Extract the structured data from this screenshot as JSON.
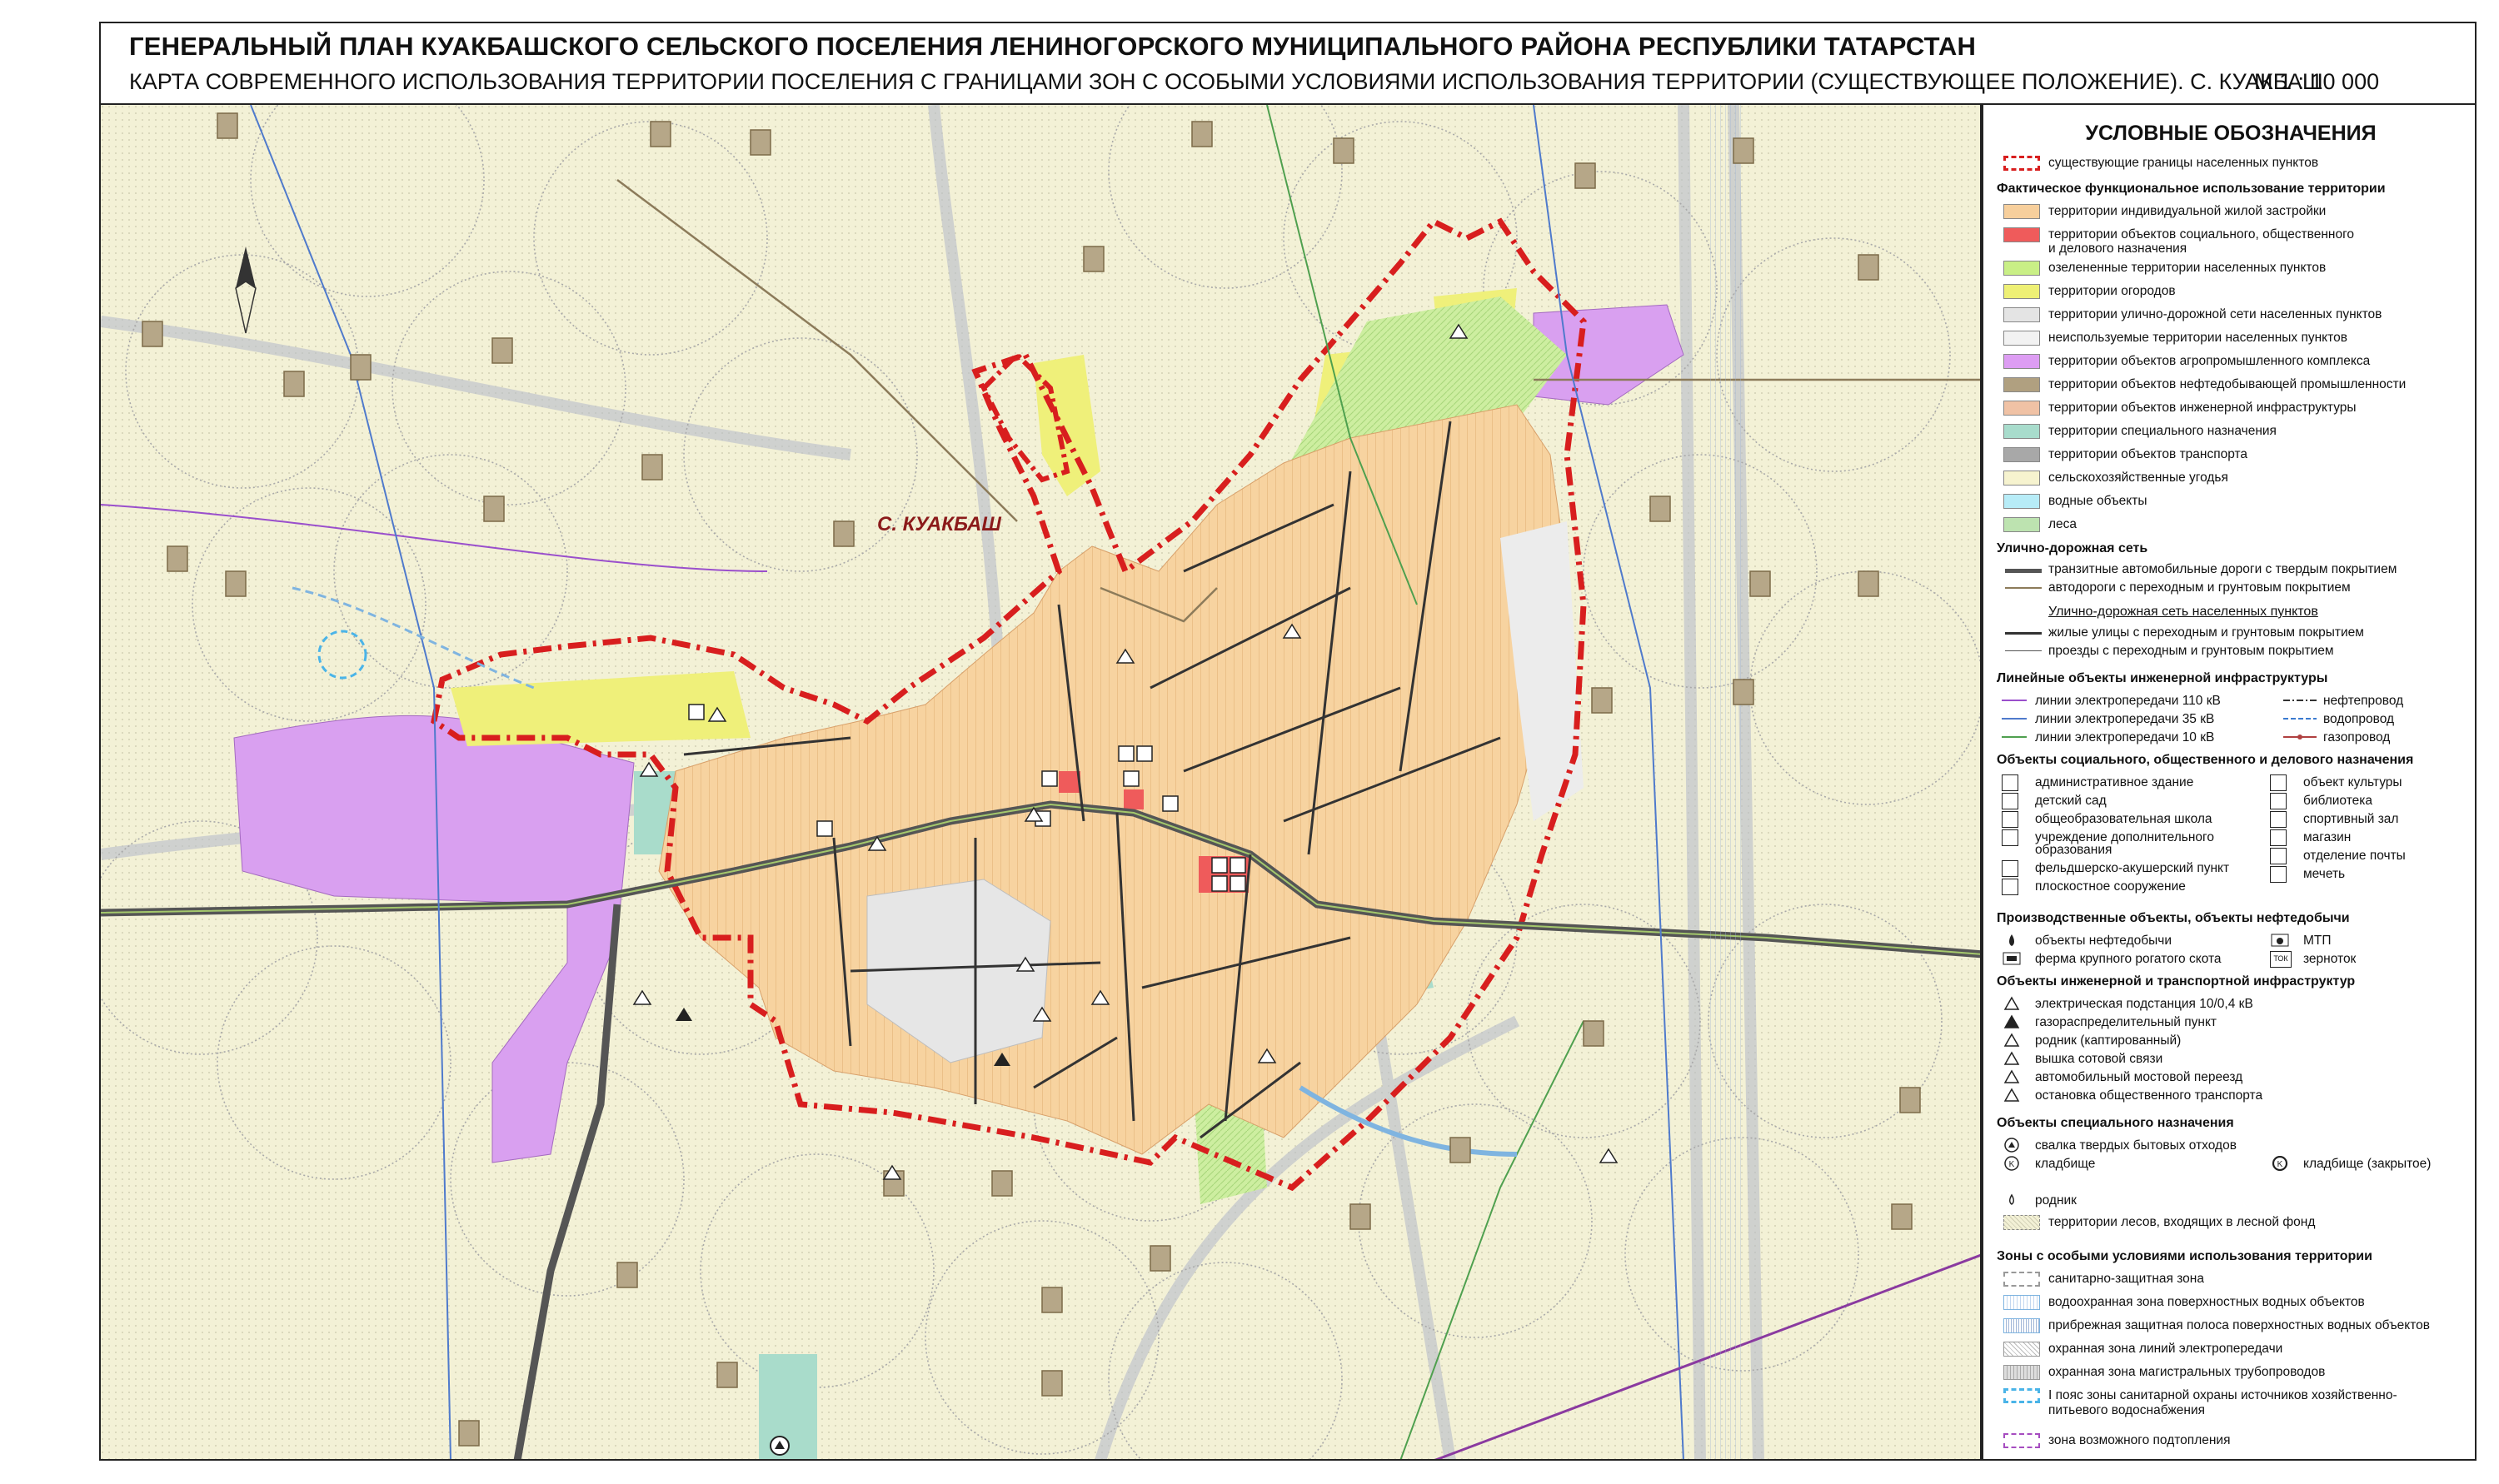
{
  "header": {
    "title": "ГЕНЕРАЛЬНЫЙ ПЛАН КУАКБАШСКОГО СЕЛЬСКОГО ПОСЕЛЕНИЯ ЛЕНИНОГОРСКОГО МУНИЦИПАЛЬНОГО РАЙОНА РЕСПУБЛИКИ ТАТАРСТАН",
    "subtitle": "КАРТА СОВРЕМЕННОГО ИСПОЛЬЗОВАНИЯ ТЕРРИТОРИИ ПОСЕЛЕНИЯ С ГРАНИЦАМИ ЗОН С ОСОБЫМИ УСЛОВИЯМИ ИСПОЛЬЗОВАНИЯ ТЕРРИТОРИИ (СУЩЕСТВУЮЩЕЕ ПОЛОЖЕНИЕ).  С. КУАКБАШ",
    "scale": "М  1 : 10 000"
  },
  "map": {
    "settlement_label": "С. КУАКБАШ",
    "north_symbol": "north-arrow-icon",
    "colors": {
      "background": "#f3f1d6",
      "residential": "#f7d3a0",
      "agro": "#d9a0f0",
      "orchards": "#eff07a",
      "greenery": "#cdeea0",
      "cemetery": "#a9dccb",
      "unused": "#e6e6e6",
      "boundary": "#d81e1e"
    }
  },
  "legend": {
    "title": "УСЛОВНЫЕ ОБОЗНАЧЕНИЯ",
    "boundary": "существующие границы населенных пунктов",
    "landuse_title": "Фактическое функциональное использование территории",
    "landuse": [
      {
        "label": "территории индивидуальной жилой застройки",
        "color": "#f7cf9c"
      },
      {
        "label": "территории объектов социального, общественного",
        "label2": "и делового назначения",
        "color": "#ef5b5b"
      },
      {
        "label": "озелененные территории населенных пунктов",
        "color": "#c9ef86"
      },
      {
        "label": "территории огородов",
        "color": "#eef075"
      },
      {
        "label": "территории улично-дорожной сети населенных пунктов",
        "color": "#e4e4e4"
      },
      {
        "label": "неиспользуемые территории населенных пунктов",
        "color": "#f2f2f2"
      },
      {
        "label": "территории объектов агропромышленного комплекса",
        "color": "#dd9df3"
      },
      {
        "label": "территории объектов нефтедобывающей промышленности",
        "color": "#b0a080"
      },
      {
        "label": "территории объектов инженерной инфраструктуры",
        "color": "#f0c2a5"
      },
      {
        "label": "территории специального назначения",
        "color": "#a8dccc"
      },
      {
        "label": "территории объектов транспорта",
        "color": "#a8a8a8"
      },
      {
        "label": "сельскохозяйственные угодья",
        "color": "#f6f3cf"
      },
      {
        "label": "водные объекты",
        "color": "#b7ecf7"
      },
      {
        "label": "леса",
        "color": "#bde3b0"
      }
    ],
    "roads_title": "Улично-дорожная сеть",
    "roads": [
      "транзитные автомобильные дороги с твердым покрытием",
      "автодороги с переходным и грунтовым покрытием"
    ],
    "streets_subtitle": "Улично-дорожная сеть населенных пунктов",
    "streets": [
      "жилые улицы с переходным и грунтовым покрытием",
      "проезды с переходным и грунтовым покрытием"
    ],
    "lines_title": "Линейные объекты инженерной инфраструктуры",
    "lines_left": [
      {
        "label": "линии электропередачи 110 кВ",
        "code": "110"
      },
      {
        "label": "линии электропередачи 35 кВ",
        "code": "35"
      },
      {
        "label": "линии электропередачи 10 кВ",
        "code": "10"
      }
    ],
    "lines_right": [
      "нефтепровод",
      "водопровод",
      "газопровод"
    ],
    "social_title": "Объекты социального, общественного и делового назначения",
    "social_left": [
      "административное здание",
      "детский сад",
      "общеобразовательная школа",
      "учреждение дополнительного",
      "образования",
      "фельдшерско-акушерский пункт",
      "плоскостное сооружение"
    ],
    "social_right": [
      "объект культуры",
      "библиотека",
      "спортивный зал",
      "магазин",
      "отделение почты",
      "мечеть"
    ],
    "industry_title": "Производственные объекты, объекты нефтедобычи",
    "industry_left": [
      "объекты нефтедобычи",
      "ферма крупного рогатого скота"
    ],
    "industry_right": [
      "МТП",
      "зерноток"
    ],
    "industry_tok": "ТОК",
    "infra_title": "Объекты инженерной и транспортной инфраструктур",
    "infra": [
      "электрическая подстанция 10/0,4 кВ",
      "газораспределительный пункт",
      "родник (каптированный)",
      "вышка сотовой связи",
      "автомобильный мостовой переезд",
      "остановка общественного транспорта"
    ],
    "special_title": "Объекты специального назначения",
    "special": [
      "свалка твердых бытовых отходов",
      "кладбище"
    ],
    "special_right": "кладбище (закрытое)",
    "spring": "родник",
    "forest_fund": "территории лесов, входящих в лесной фонд",
    "zones_title": "Зоны с особыми условиями использования территории",
    "zones": [
      "санитарно-защитная зона",
      "водоохранная зона поверхностных водных объектов",
      "прибрежная защитная полоса поверхностных водных объектов",
      "охранная зона линий электропередачи",
      "охранная зона магистральных трубопроводов",
      "I пояс зоны санитарной охраны источников хозяйственно-",
      "питьевого водоснабжения"
    ],
    "flood": "зона возможного подтопления"
  }
}
